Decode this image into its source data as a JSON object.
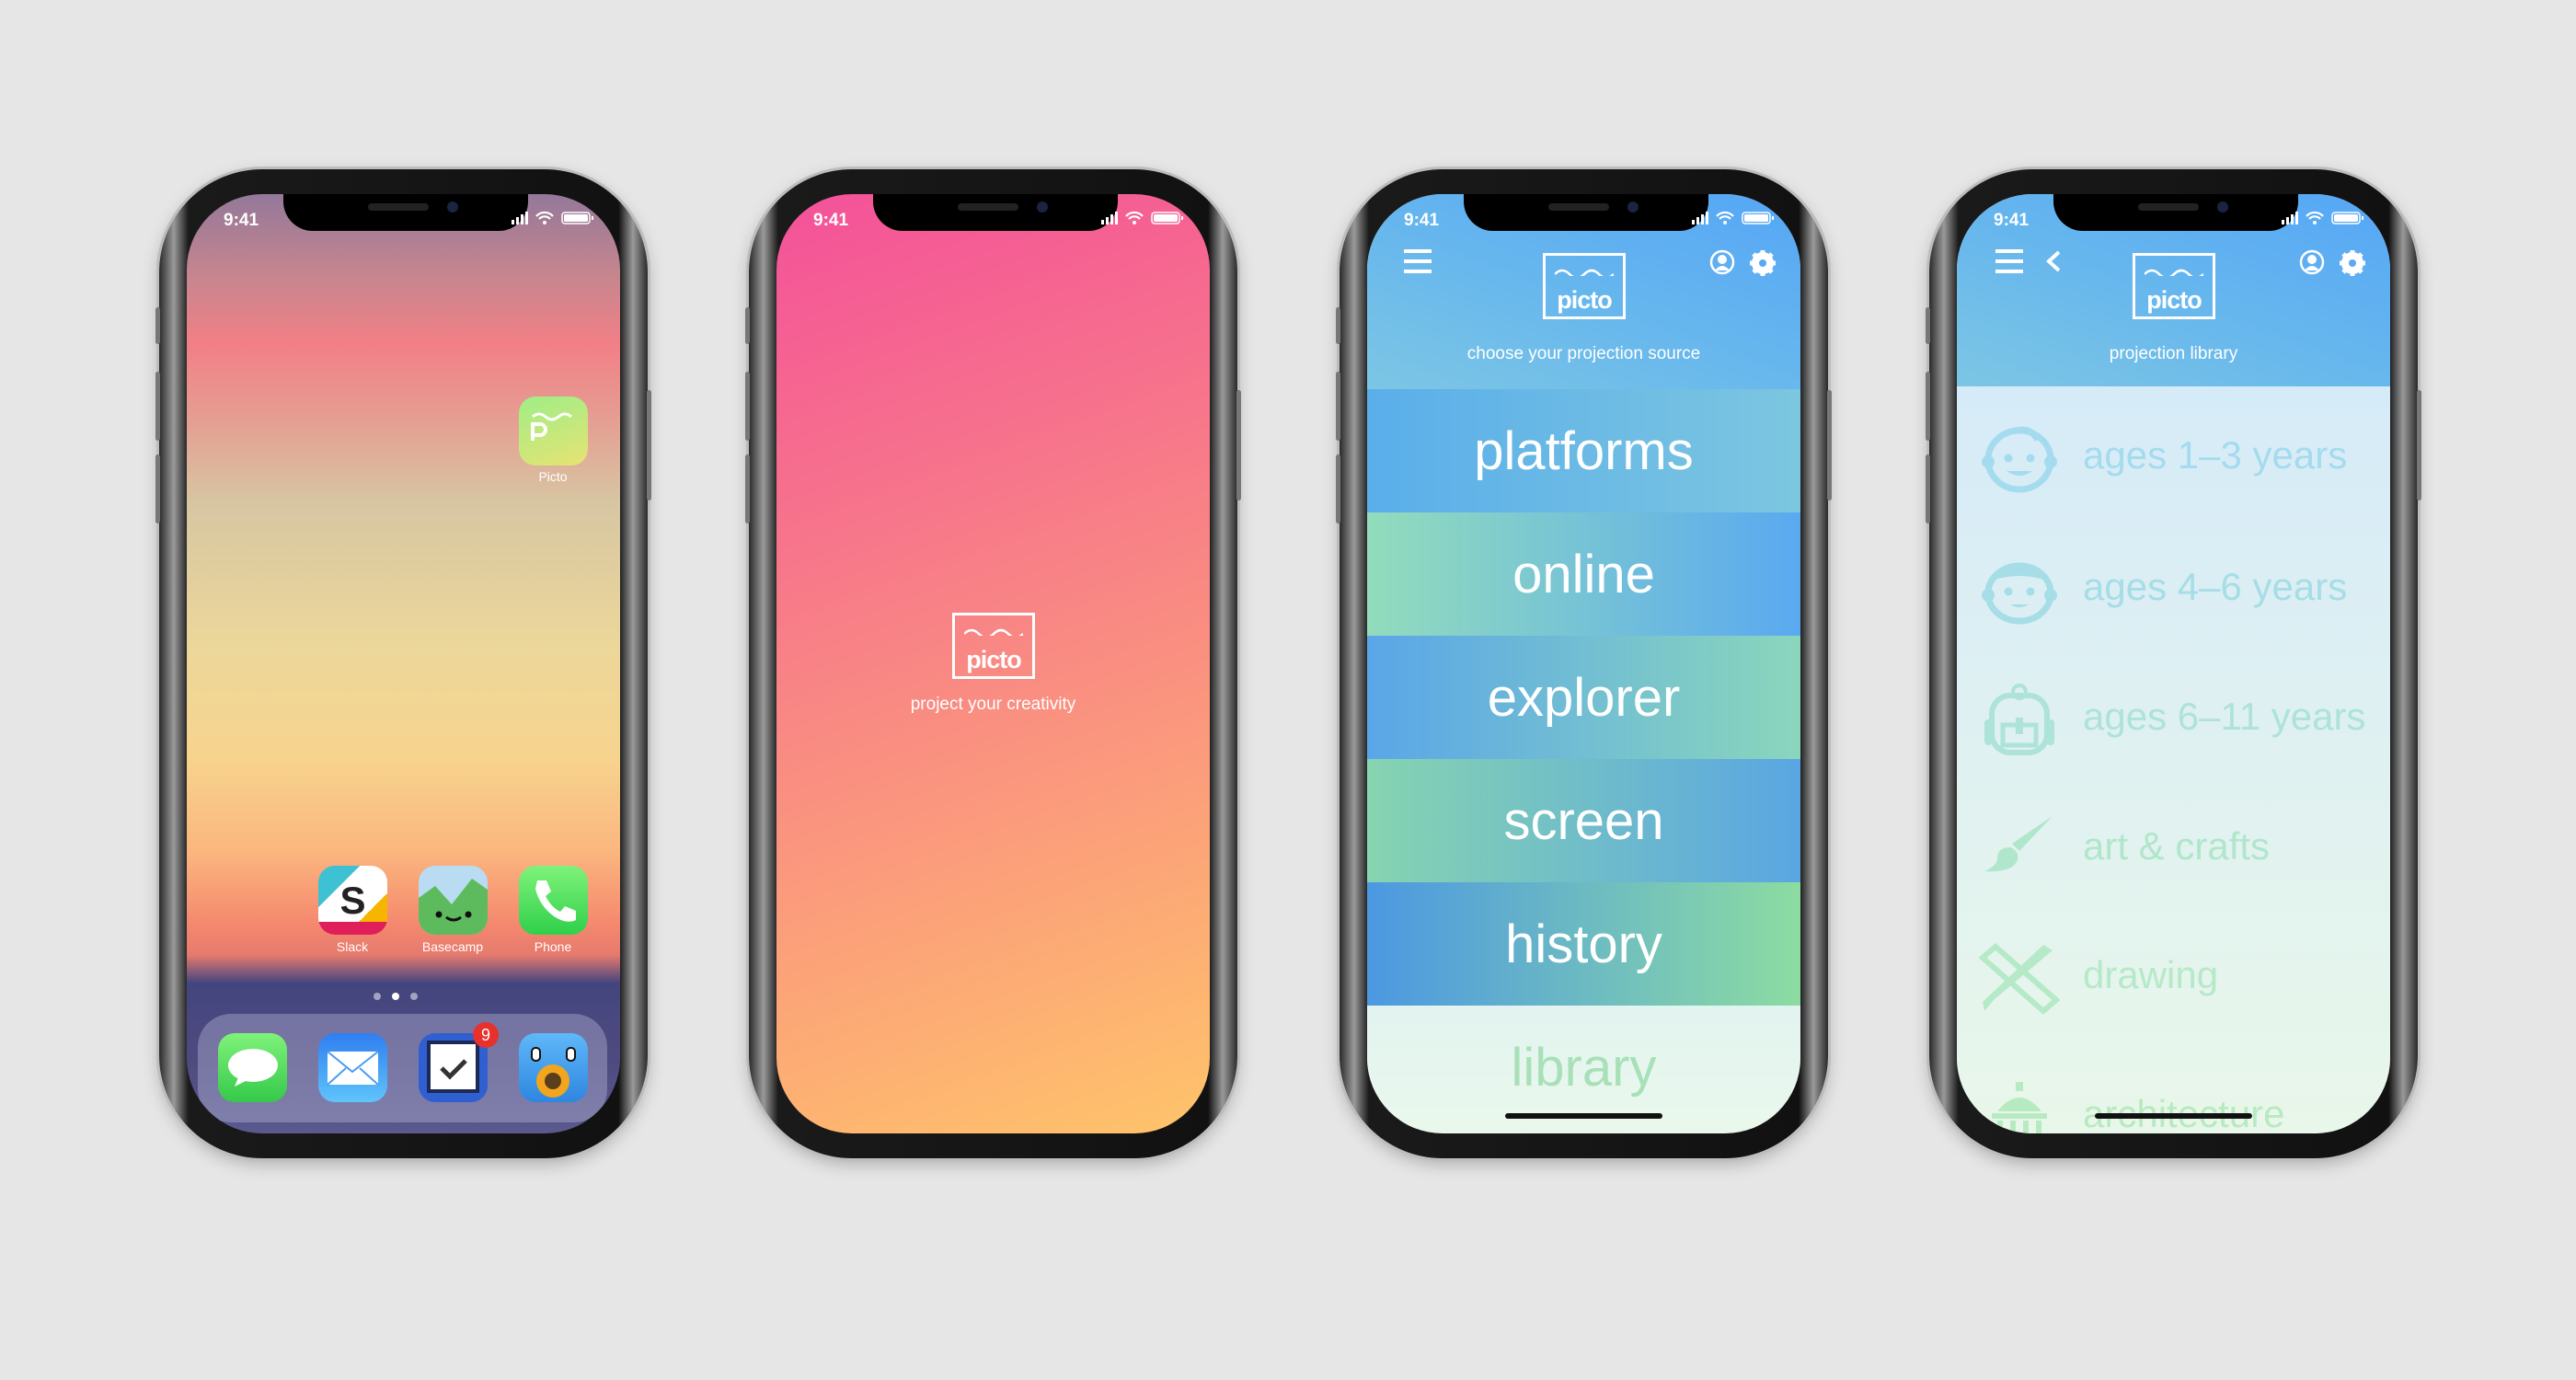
{
  "status": {
    "time": "9:41"
  },
  "logo_text": "picto",
  "home_screen": {
    "apps": [
      {
        "label": "Picto",
        "icon": "picto-app-icon"
      },
      {
        "label": "Slack",
        "icon": "slack-icon"
      },
      {
        "label": "Basecamp",
        "icon": "basecamp-icon"
      },
      {
        "label": "Phone",
        "icon": "phone-icon"
      }
    ],
    "dock": [
      {
        "icon": "messages-icon"
      },
      {
        "icon": "mail-icon"
      },
      {
        "icon": "tasks-icon",
        "badge": "9"
      },
      {
        "icon": "tweetbot-icon"
      }
    ],
    "page_dots": 3,
    "active_page": 2
  },
  "splash": {
    "tagline": "project your creativity",
    "gradient": [
      "#f45199",
      "#ffc46a"
    ]
  },
  "sources": {
    "subtitle": "choose your projection source",
    "items": [
      "platforms",
      "online",
      "explorer",
      "screen",
      "history",
      "library"
    ]
  },
  "library": {
    "subtitle": "projection library",
    "items": [
      {
        "label": "ages 1–3 years",
        "icon": "baby-face-icon",
        "color": "#a5dbee"
      },
      {
        "label": "ages 4–6 years",
        "icon": "child-face-icon",
        "color": "#a6dde6"
      },
      {
        "label": "ages 6–11 years",
        "icon": "backpack-icon",
        "color": "#ade3d8"
      },
      {
        "label": "art & crafts",
        "icon": "paintbrush-icon",
        "color": "#b0e6cc"
      },
      {
        "label": "drawing",
        "icon": "pencil-ruler-icon",
        "color": "#b6e9c8"
      },
      {
        "label": "architecture",
        "icon": "building-icon",
        "color": "#b8eac2"
      }
    ]
  },
  "colors": {
    "header_blue": "#55a6f6",
    "library_text": "#a8e0b8",
    "background": "#e6e6e6"
  }
}
